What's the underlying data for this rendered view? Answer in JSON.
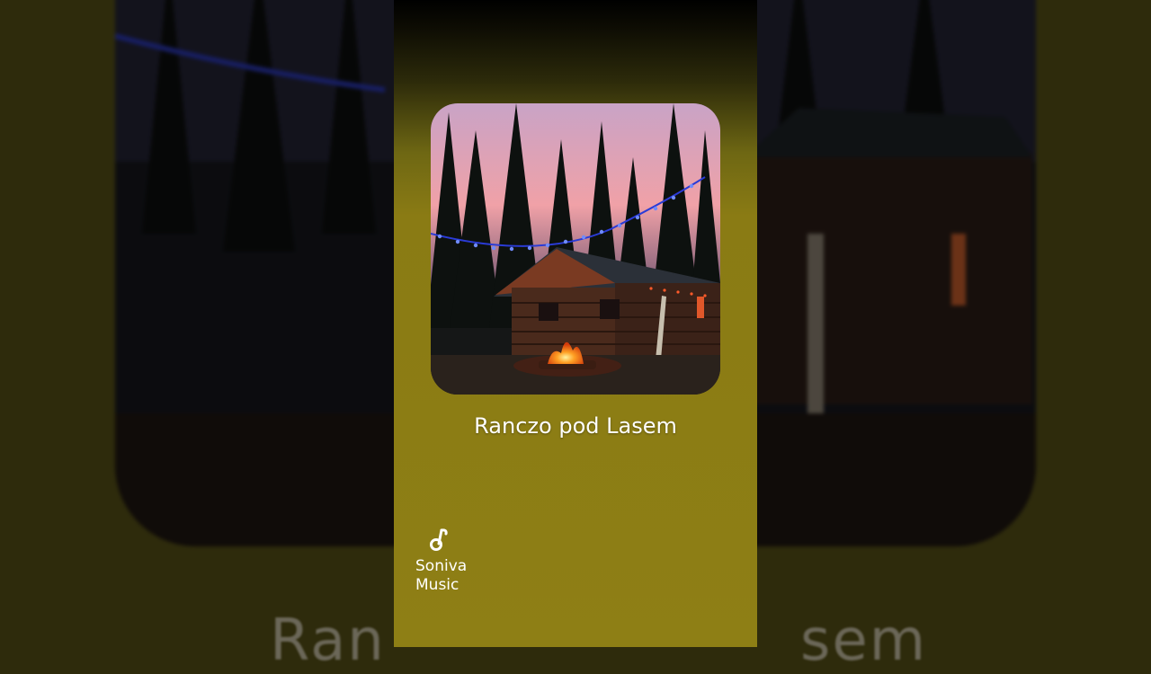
{
  "track": {
    "title": "Ranczo pod Lasem"
  },
  "background": {
    "title_left": "Ran",
    "title_right": "sem"
  },
  "brand": {
    "icon": "music-note-icon",
    "line1": "Soniva",
    "line2": "Music"
  },
  "colors": {
    "panel": "#8e7f15",
    "sky": "#f0a1a7",
    "lights": "#3b5bff",
    "fire": "#ff8a1a"
  }
}
